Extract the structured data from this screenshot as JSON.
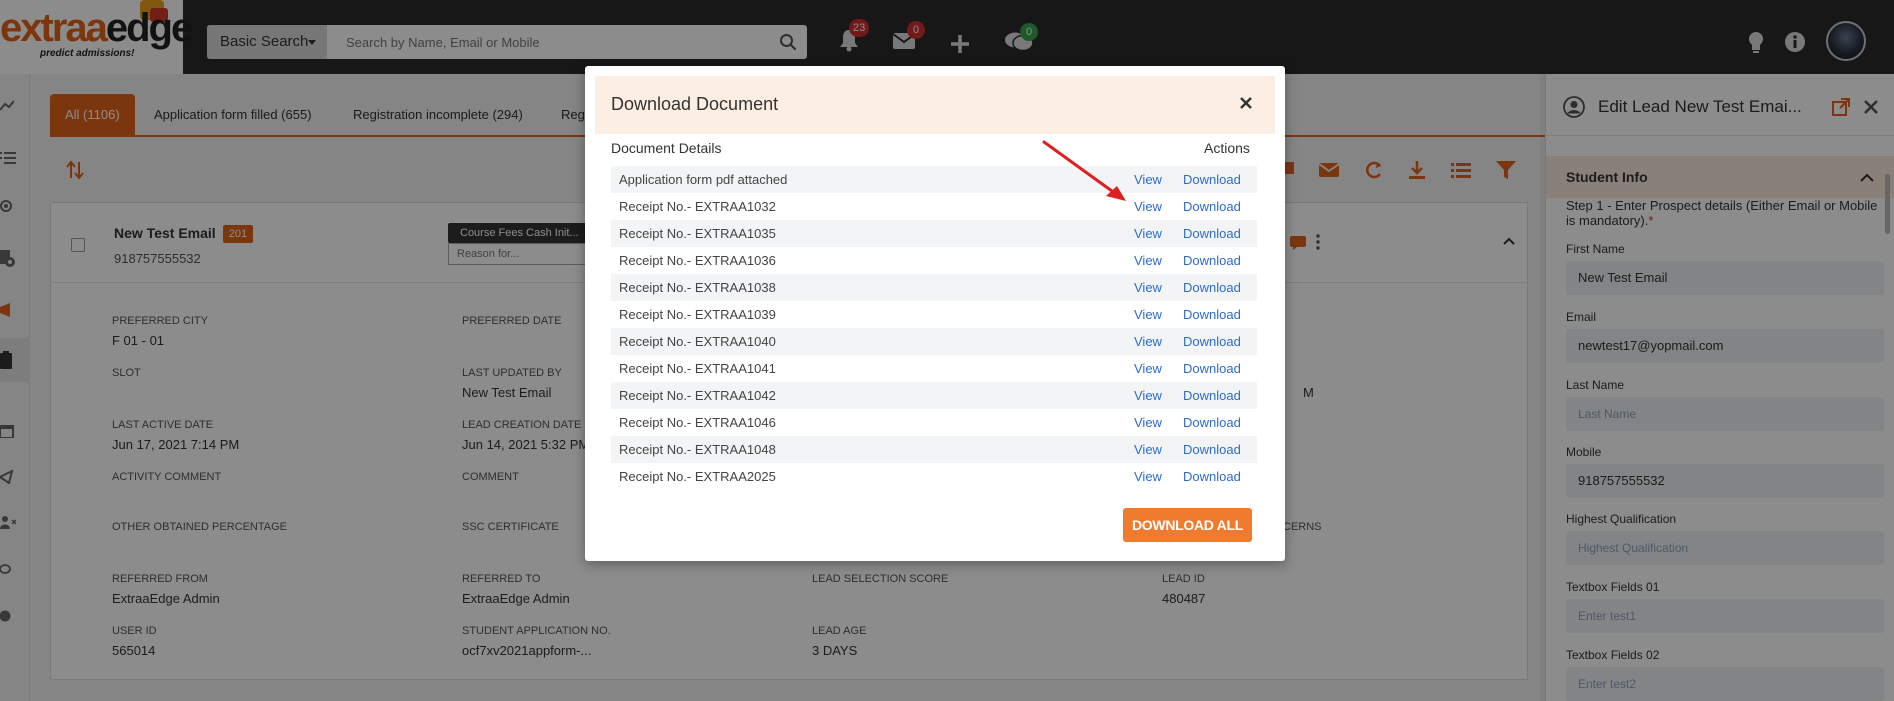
{
  "header": {
    "logo_text_a": "extraa",
    "logo_text_b": "edge",
    "logo_tagline": "predict admissions!",
    "search": {
      "type_label": "Basic Search",
      "placeholder": "Search by Name, Email or Mobile"
    },
    "notifications_count": "23",
    "messages_count": "0",
    "chats_count": "0",
    "accent_color": "#e2631b"
  },
  "tabs": [
    {
      "label": "All (1106)"
    },
    {
      "label": "Application form filled (655)"
    },
    {
      "label": "Registration incomplete (294)"
    },
    {
      "label": "Reg"
    }
  ],
  "lead": {
    "name": "New Test Email",
    "flag": "201",
    "phone": "918757555532",
    "fees_tag": "Course Fees Cash Init...",
    "reason_placeholder": "Reason for...",
    "fields": [
      {
        "label": "PREFERRED CITY",
        "value": "F 01 - 01"
      },
      {
        "label": "PREFERRED DATE",
        "value": ""
      },
      {
        "label": "SLOT",
        "value": ""
      },
      {
        "label": "LAST UPDATED BY",
        "value": "New Test Email"
      },
      {
        "label": "LAST ACTIVE DATE",
        "value": "Jun 17, 2021 7:14 PM"
      },
      {
        "label": "LEAD CREATION DATE",
        "value": "Jun 14, 2021 5:32 PM"
      },
      {
        "label": "ACTIVITY COMMENT",
        "value": ""
      },
      {
        "label": "COMMENT",
        "value": ""
      },
      {
        "label": "OTHER OBTAINED PERCENTAGE",
        "value": ""
      },
      {
        "label": "SSC CERTIFICATE",
        "value": ""
      },
      {
        "label": "REFERRED FROM",
        "value": "ExtraaEdge Admin"
      },
      {
        "label": "REFERRED TO",
        "value": "ExtraaEdge Admin"
      },
      {
        "label": "LEAD SELECTION SCORE",
        "value": ""
      },
      {
        "label": "LEAD ID",
        "value": "480487"
      },
      {
        "label": "USER ID",
        "value": "565014"
      },
      {
        "label": "STUDENT APPLICATION NO.",
        "value": "ocf7xv2021appform-..."
      },
      {
        "label": "LEAD AGE",
        "value": "3 DAYS"
      }
    ],
    "partial_right_1": "M",
    "partial_right_2": "CERNS"
  },
  "right_panel": {
    "title": "Edit Lead New Test Emai...",
    "section": "Student Info",
    "step_text": "Step 1 - Enter Prospect details (Either Email or Mobile is mandatory).",
    "required_mark": "*",
    "fields": [
      {
        "label": "First Name",
        "value": "New Test Email",
        "placeholder": false
      },
      {
        "label": "Email",
        "value": "newtest17@yopmail.com",
        "placeholder": false
      },
      {
        "label": "Last Name",
        "value": "Last Name",
        "placeholder": true
      },
      {
        "label": "Mobile",
        "value": "918757555532",
        "placeholder": false
      },
      {
        "label": "Highest Qualification",
        "value": "Highest Qualification",
        "placeholder": true
      },
      {
        "label": "Textbox Fields 01",
        "value": "Enter test1",
        "placeholder": true
      },
      {
        "label": "Textbox Fields 02",
        "value": "Enter test2",
        "placeholder": true
      }
    ]
  },
  "modal": {
    "title": "Download Document",
    "col_details": "Document Details",
    "col_actions": "Actions",
    "view_label": "View",
    "download_label": "Download",
    "documents": [
      "Application form pdf attached",
      "Receipt No.- EXTRAA1032",
      "Receipt No.- EXTRAA1035",
      "Receipt No.- EXTRAA1036",
      "Receipt No.- EXTRAA1038",
      "Receipt No.- EXTRAA1039",
      "Receipt No.- EXTRAA1040",
      "Receipt No.- EXTRAA1041",
      "Receipt No.- EXTRAA1042",
      "Receipt No.- EXTRAA1046",
      "Receipt No.- EXTRAA1048",
      "Receipt No.- EXTRAA2025"
    ],
    "download_all_label": "DOWNLOAD ALL"
  }
}
